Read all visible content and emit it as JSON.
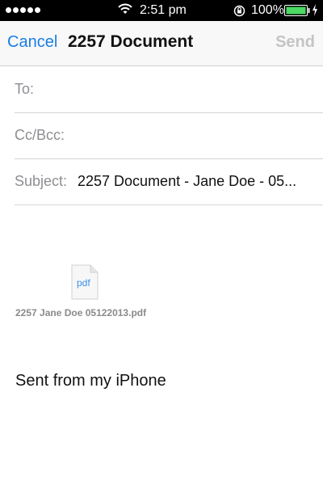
{
  "status_bar": {
    "time": "2:51 pm",
    "battery_percent": "100%",
    "signal_bars": 5,
    "icons": [
      "wifi-icon",
      "orientation-lock-icon",
      "battery-icon",
      "charging-icon"
    ]
  },
  "nav": {
    "cancel_label": "Cancel",
    "title": "2257 Document",
    "send_label": "Send",
    "accent_color": "#1a7ee6",
    "disabled_color": "#c4c4c4"
  },
  "fields": {
    "to_label": "To:",
    "to_value": "",
    "ccbcc_label": "Cc/Bcc:",
    "ccbcc_value": "",
    "subject_label": "Subject:",
    "subject_value": "2257 Document - Jane Doe - 05..."
  },
  "attachment": {
    "icon_text": "pdf",
    "filename": "2257 Jane Doe 05122013.pdf"
  },
  "body": {
    "signature": "Sent from my iPhone"
  }
}
